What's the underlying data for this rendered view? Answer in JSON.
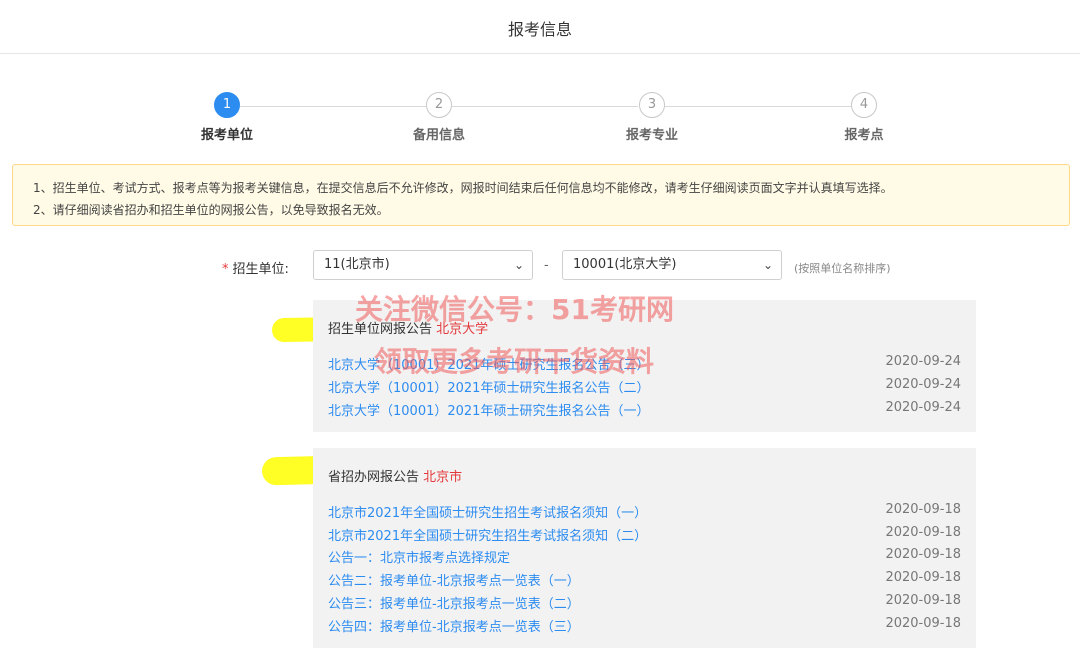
{
  "header": {
    "title": "报考信息"
  },
  "steps": [
    {
      "num": "1",
      "label": "报考单位",
      "active": true
    },
    {
      "num": "2",
      "label": "备用信息",
      "active": false
    },
    {
      "num": "3",
      "label": "报考专业",
      "active": false
    },
    {
      "num": "4",
      "label": "报考点",
      "active": false
    }
  ],
  "notice": {
    "lines": [
      "1、招生单位、考试方式、报考点等为报考关键信息，在提交信息后不允许修改，网报时间结束后任何信息均不能修改，请考生仔细阅读页面文字并认真填写选择。",
      "2、请仔细阅读省招办和招生单位的网报公告，以免导致报名无效。"
    ]
  },
  "unit_form": {
    "required_mark": "*",
    "label": "招生单位:",
    "province_value": "11(北京市)",
    "unit_value": "10001(北京大学)",
    "separator": "-",
    "sort_note": "(按照单位名称排序)"
  },
  "unit_announcements": {
    "title": "招生单位网报公告",
    "highlight": "北京大学",
    "items": [
      {
        "title": "北京大学（10001）2021年硕士研究生报名公告（三）",
        "date": "2020-09-24"
      },
      {
        "title": "北京大学（10001）2021年硕士研究生报名公告（二）",
        "date": "2020-09-24"
      },
      {
        "title": "北京大学（10001）2021年硕士研究生报名公告（一）",
        "date": "2020-09-24"
      }
    ]
  },
  "province_announcements": {
    "title": "省招办网报公告",
    "highlight": "北京市",
    "items": [
      {
        "title": "北京市2021年全国硕士研究生招生考试报名须知（一）",
        "date": "2020-09-18"
      },
      {
        "title": "北京市2021年全国硕士研究生招生考试报名须知（二）",
        "date": "2020-09-18"
      },
      {
        "title": "公告一：北京市报考点选择规定",
        "date": "2020-09-18"
      },
      {
        "title": "公告二：报考单位-北京报考点一览表（一）",
        "date": "2020-09-18"
      },
      {
        "title": "公告三：报考单位-北京报考点一览表（二）",
        "date": "2020-09-18"
      },
      {
        "title": "公告四：报考单位-北京报考点一览表（三）",
        "date": "2020-09-18"
      }
    ]
  },
  "watermark": {
    "line1": "关注微信公号：51考研网",
    "line2": "领取更多考研干货资料"
  },
  "colors": {
    "accent": "#2d8cf0",
    "highlight": "#e4393c",
    "marker": "#ffff1a",
    "notice_bg": "#fffbe6"
  },
  "icons": {
    "select_arrow": "chevron-down-icon"
  }
}
